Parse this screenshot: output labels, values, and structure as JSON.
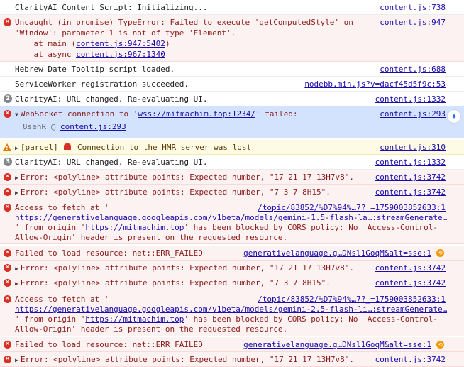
{
  "console": {
    "rows": [
      {
        "type": "info",
        "msg": "ClarityAI Content Script: Initializing...",
        "src": "content.js:738"
      },
      {
        "type": "error",
        "msg": "Uncaught (in promise) TypeError: Failed to execute 'getComputedStyle' on",
        "msg2": "'Window': parameter 1 is not of type 'Element'.",
        "stack1_prefix": "    at main (",
        "stack1_link": "content.js:947:5402",
        "stack1_suffix": ")",
        "stack2_prefix": "    at async ",
        "stack2_link": "content.js:967:1340",
        "src": "content.js:947"
      },
      {
        "type": "info",
        "msg": "Hebrew Date Tooltip script loaded.",
        "src": "content.js:688"
      },
      {
        "type": "info",
        "msg": "ServiceWorker registration succeeded.",
        "src": "nodebb.min.js?v=dacf45d5f9c:53"
      },
      {
        "type": "info",
        "count": "2",
        "msg": "ClarityAI: URL changed. Re-evaluating UI.",
        "src": "content.js:1332"
      },
      {
        "type": "error",
        "msg_prefix": "WebSocket connection to '",
        "msg_link": "wss://mitmachim.top:1234/",
        "msg_suffix": "' failed:",
        "detail_prefix": "8sehR @ ",
        "detail_link": "content.js:293",
        "src": "content.js:293"
      },
      {
        "type": "warning",
        "msg_prefix": "[parcel] ",
        "msg_suffix": " Connection to the HMR server was lost",
        "src": "content.js:310"
      },
      {
        "type": "info",
        "count": "3",
        "msg": "ClarityAI: URL changed. Re-evaluating UI.",
        "src": "content.js:1332"
      },
      {
        "type": "error",
        "msg": "Error: <polyline> attribute points: Expected number, \"17 21 17 13H7v8\".",
        "src": "content.js:3742"
      },
      {
        "type": "error",
        "msg": "Error: <polyline> attribute points: Expected number, \"7 3 7 8H15\".",
        "src": "content.js:3742"
      },
      {
        "type": "error",
        "msg": "Access to fetch at '",
        "src": "/topic/83852/%D7%94%…7?_=1759003852633:1",
        "url": "https://generativelanguage.googleapis.com/v1beta/models/gemini-1.5-flash-la…:streamGenerate…",
        "l3_prefix": "' from origin '",
        "l3_link": "https://mitmachim.top",
        "l3_suffix": "' has been blocked by CORS policy: No 'Access-Control-",
        "l4": "Allow-Origin' header is present on the requested resource."
      },
      {
        "type": "error",
        "msg": "Failed to load resource: net::ERR_FAILED",
        "src": "generativelanguage.g…DNsl1GoqM&alt=sse:1"
      },
      {
        "type": "error",
        "msg": "Error: <polyline> attribute points: Expected number, \"17 21 17 13H7v8\".",
        "src": "content.js:3742"
      },
      {
        "type": "error",
        "msg": "Error: <polyline> attribute points: Expected number, \"7 3 7 8H15\".",
        "src": "content.js:3742"
      },
      {
        "type": "error",
        "msg": "Access to fetch at '",
        "src": "/topic/83852/%D7%94%…7?_=1759003852633:1",
        "url": "https://generativelanguage.googleapis.com/v1beta/models/gemini-2.5-flash-li…:streamGenerate…",
        "l3_prefix": "' from origin '",
        "l3_link": "https://mitmachim.top",
        "l3_suffix": "' has been blocked by CORS policy: No 'Access-Control-",
        "l4": "Allow-Origin' header is present on the requested resource."
      },
      {
        "type": "error",
        "msg": "Failed to load resource: net::ERR_FAILED",
        "src": "generativelanguage.g…DNsl1GoqM&alt=sse:1"
      },
      {
        "type": "error",
        "msg": "Error: <polyline> attribute points: Expected number, \"17 21 17 13H7v8\".",
        "src": "content.js:3742"
      }
    ]
  }
}
